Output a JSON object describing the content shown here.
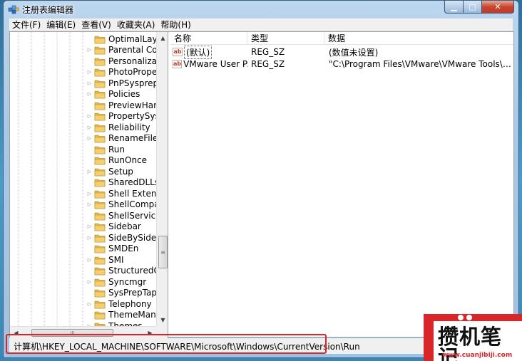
{
  "window": {
    "title": "注册表编辑器"
  },
  "caption_buttons": {
    "minimize": "▁",
    "maximize": "□",
    "close": "✕"
  },
  "menu": [
    "文件(F)",
    "编辑(E)",
    "查看(V)",
    "收藏夹(A)",
    "帮助(H)"
  ],
  "tree": {
    "items": [
      {
        "label": "OptimalLayout",
        "expandable": false
      },
      {
        "label": "Parental Controls",
        "expandable": true
      },
      {
        "label": "Personalization",
        "expandable": false
      },
      {
        "label": "PhotoPropertyHandler",
        "expandable": true
      },
      {
        "label": "PnPSysprep",
        "expandable": true
      },
      {
        "label": "Policies",
        "expandable": true
      },
      {
        "label": "PreviewHandlers",
        "expandable": false
      },
      {
        "label": "PropertySystem",
        "expandable": true
      },
      {
        "label": "Reliability",
        "expandable": true
      },
      {
        "label": "RenameFiles",
        "expandable": true
      },
      {
        "label": "Run",
        "expandable": false
      },
      {
        "label": "RunOnce",
        "expandable": false
      },
      {
        "label": "Setup",
        "expandable": true
      },
      {
        "label": "SharedDLLs",
        "expandable": false
      },
      {
        "label": "Shell Extensions",
        "expandable": true
      },
      {
        "label": "ShellCompatibility",
        "expandable": true
      },
      {
        "label": "ShellServiceObjectDelayLoad",
        "expandable": false
      },
      {
        "label": "Sidebar",
        "expandable": true
      },
      {
        "label": "SideBySide",
        "expandable": true
      },
      {
        "label": "SMDEn",
        "expandable": false
      },
      {
        "label": "SMI",
        "expandable": true
      },
      {
        "label": "StructuredQuery",
        "expandable": false
      },
      {
        "label": "Syncmgr",
        "expandable": true
      },
      {
        "label": "SysPrepTapi",
        "expandable": false
      },
      {
        "label": "Telephony",
        "expandable": true
      },
      {
        "label": "ThemeManager",
        "expandable": false
      },
      {
        "label": "Themes",
        "expandable": true
      }
    ]
  },
  "list": {
    "columns": [
      "名称",
      "类型",
      "数据"
    ],
    "rows": [
      {
        "name": "(默认)",
        "type": "REG_SZ",
        "data": "(数值未设置)"
      },
      {
        "name": "VMware User P...",
        "type": "REG_SZ",
        "data": "\"C:\\Program Files\\VMware\\VMware Tools\\vmto..."
      }
    ]
  },
  "statusbar": {
    "path": "计算机\\HKEY_LOCAL_MACHINE\\SOFTWARE\\Microsoft\\Windows\\CurrentVersion\\Run"
  },
  "scroll": {
    "up": "▲",
    "down": "▼",
    "left": "◀",
    "right": "▶",
    "grip_v": "≡",
    "grip_h": "III"
  },
  "watermark": {
    "text": "攒机笔记",
    "url": "www.cuanjibiji.com"
  },
  "colors": {
    "highlight": "#d9262b",
    "folder": "#e8b84a"
  }
}
